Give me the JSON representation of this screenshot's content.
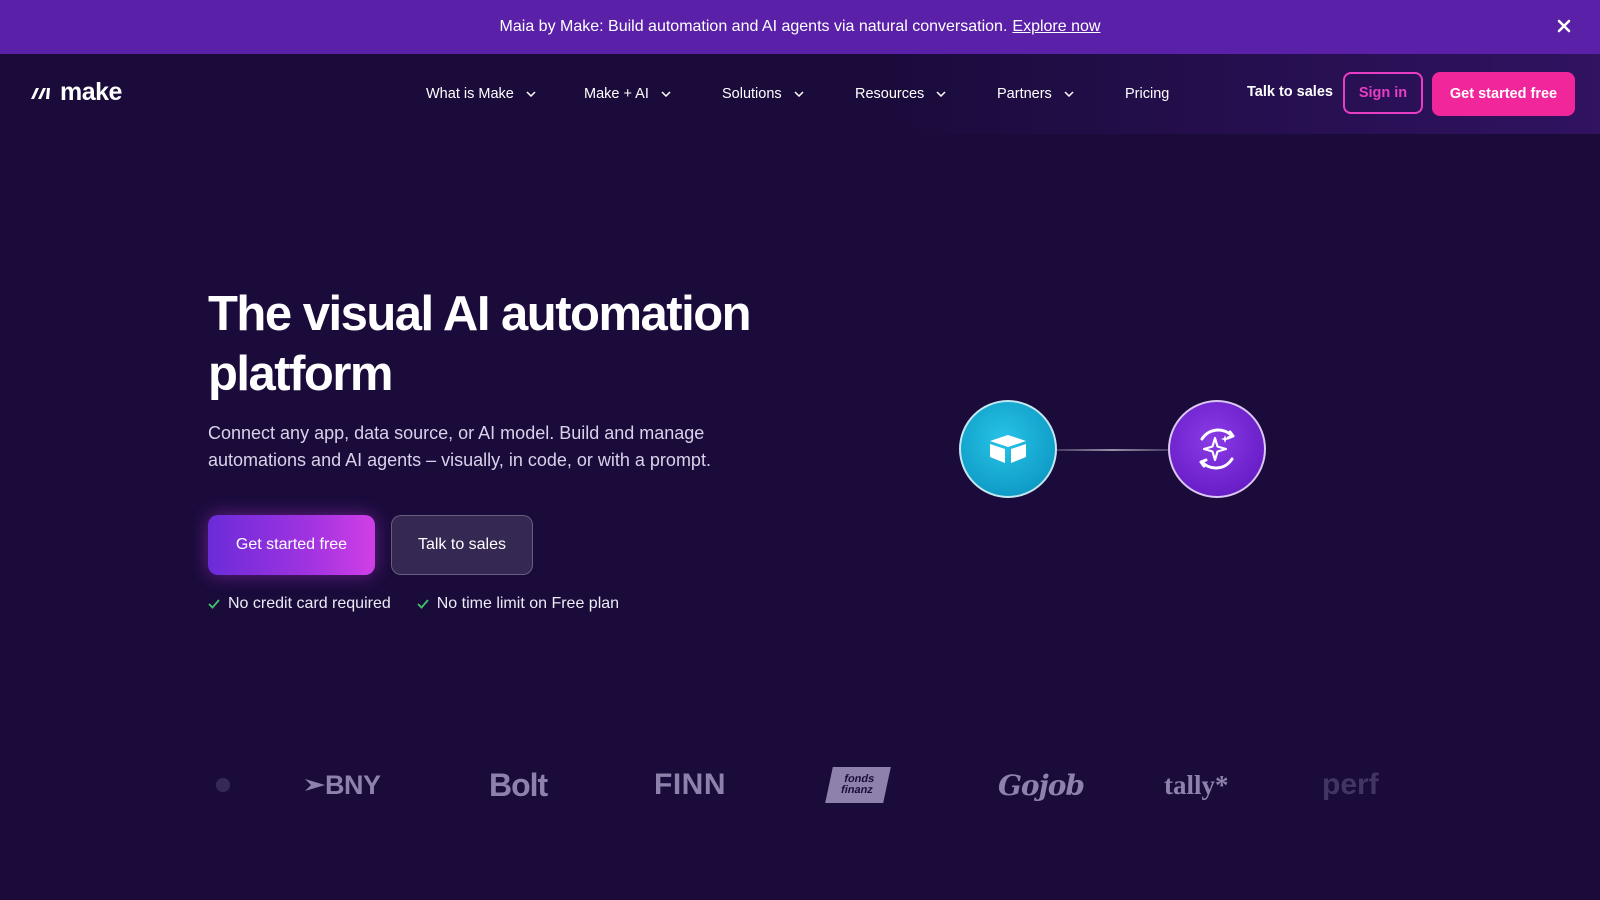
{
  "banner": {
    "text": "Maia by Make: Build automation and AI agents via natural conversation.",
    "link": "Explore now",
    "close_icon": "close-icon"
  },
  "nav": {
    "logo_text": "make",
    "menu": [
      {
        "label": "What is Make",
        "dropdown": true
      },
      {
        "label": "Make + AI",
        "dropdown": true
      },
      {
        "label": "Solutions",
        "dropdown": true
      },
      {
        "label": "Resources",
        "dropdown": true
      },
      {
        "label": "Partners",
        "dropdown": true
      },
      {
        "label": "Pricing",
        "dropdown": false
      }
    ],
    "talk_to_sales": "Talk to sales",
    "sign_in": "Sign in",
    "get_started": "Get started free"
  },
  "hero": {
    "title_line1": "The visual AI automation",
    "title_line2": "platform",
    "subtitle_line1": "Connect any app, data source, or AI model. Build and manage",
    "subtitle_line2": "automations and AI agents – visually, in code, or with a prompt.",
    "primary_button": "Get started free",
    "secondary_button": "Talk to sales",
    "checks": [
      "No credit card required",
      "No time limit on Free plan"
    ]
  },
  "diagram": {
    "nodes": [
      {
        "icon": "box-icon",
        "color": "#1aa8d6"
      },
      {
        "icon": "ai-sparkle-icon",
        "color": "#7a2bd8"
      }
    ]
  },
  "logos": [
    "BNY",
    "Bolt",
    "FINN",
    "fonds finanz",
    "Gojob",
    "tally*",
    "perf"
  ],
  "colors": {
    "background": "#1a0b3b",
    "banner": "#5a21a8",
    "accent_pink": "#f1269a",
    "accent_purple": "#a033e0"
  }
}
